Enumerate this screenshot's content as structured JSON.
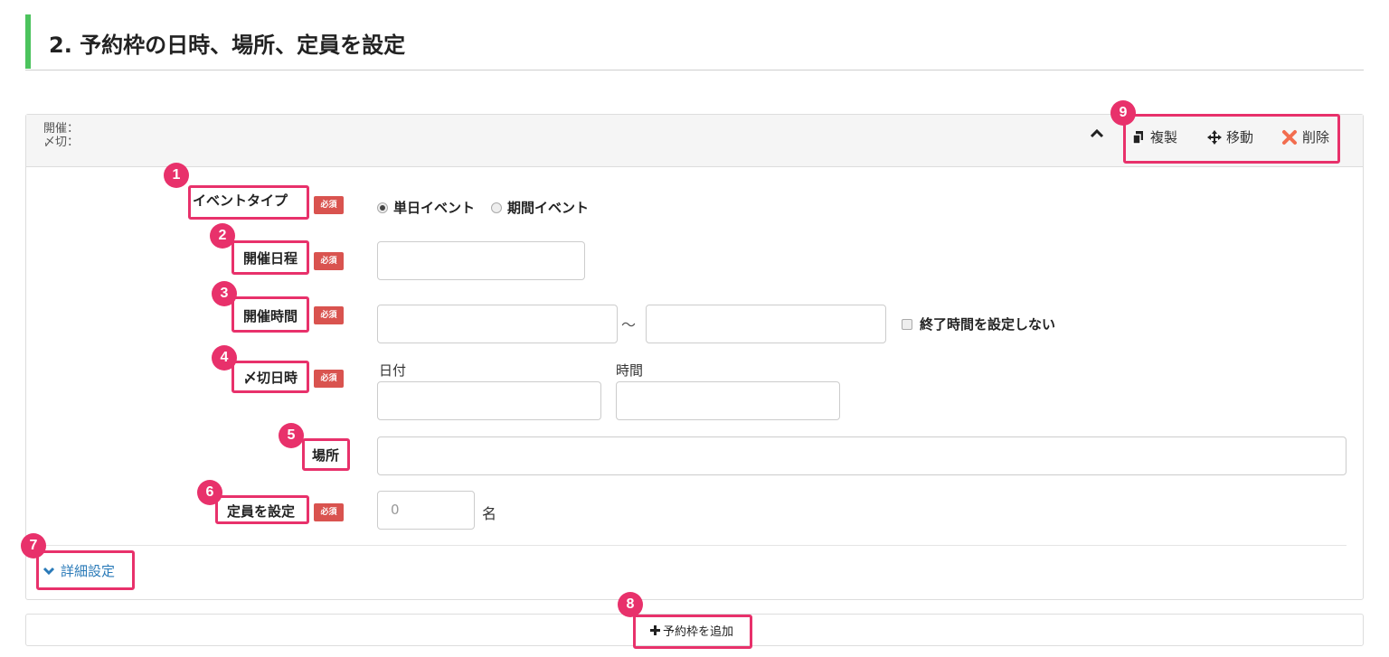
{
  "section": {
    "title": "2. 予約枠の日時、場所、定員を設定"
  },
  "panel": {
    "header_label_1": "開催：",
    "header_label_2": "〆切：",
    "toolbar": {
      "duplicate_label": "複製",
      "move_label": "移動",
      "delete_label": "削除"
    }
  },
  "form": {
    "required_badge": "必須",
    "event_type": {
      "label": "イベントタイプ",
      "options": [
        "単日イベント",
        "期間イベント"
      ],
      "selected": "単日イベント"
    },
    "event_date": {
      "label": "開催日程",
      "value": ""
    },
    "event_time": {
      "label": "開催時間",
      "separator": "～",
      "start_value": "",
      "end_value": "",
      "no_end_checkbox_label": "終了時間を設定しない"
    },
    "deadline": {
      "label": "〆切日時",
      "date_label": "日付",
      "time_label": "時間"
    },
    "place": {
      "label": "場所",
      "value": ""
    },
    "capacity": {
      "label": "定員を設定",
      "placeholder": "0",
      "unit": "名"
    }
  },
  "details": {
    "label": "詳細設定"
  },
  "add_slot": {
    "label": "予約枠を追加"
  },
  "annotations": [
    "1",
    "2",
    "3",
    "4",
    "5",
    "6",
    "7",
    "8",
    "9"
  ],
  "colors": {
    "accent_green": "#4cc35d",
    "highlight_pink": "#e8316b",
    "required_red": "#d9534f",
    "link_blue": "#2a7ab8"
  }
}
